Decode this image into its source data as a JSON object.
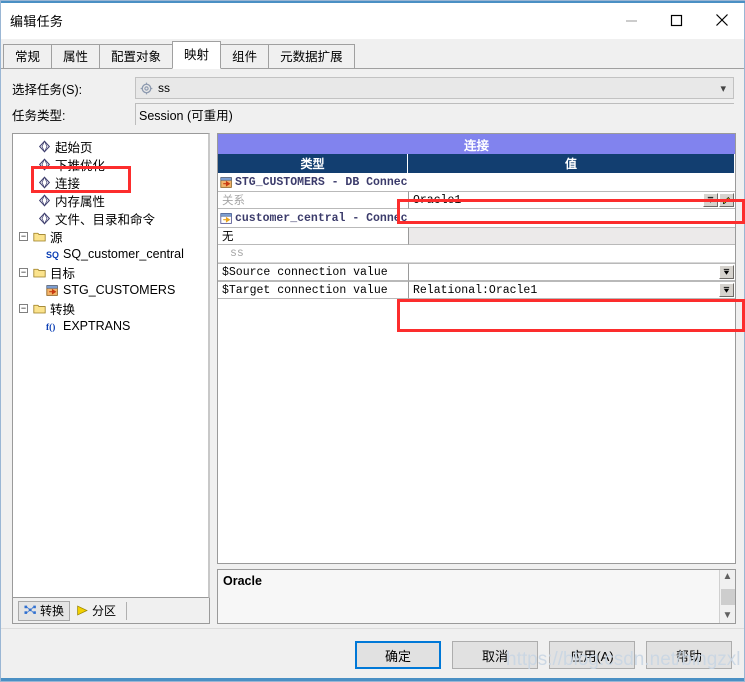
{
  "window": {
    "title": "编辑任务",
    "controls": {
      "minimize": "minimize-icon",
      "maximize": "maximize-icon",
      "close": "close-icon"
    }
  },
  "tabs": [
    {
      "label": "常规",
      "active": false
    },
    {
      "label": "属性",
      "active": false
    },
    {
      "label": "配置对象",
      "active": false
    },
    {
      "label": "映射",
      "active": true
    },
    {
      "label": "组件",
      "active": false
    },
    {
      "label": "元数据扩展",
      "active": false
    }
  ],
  "form": {
    "task_label": "选择任务(S):",
    "task_value": "ss",
    "task_icon": "gear-icon",
    "type_label": "任务类型:",
    "type_value": "Session (可重用)"
  },
  "tree": {
    "nodes": [
      {
        "label": "起始页",
        "icon": "gem-icon",
        "indent": 1,
        "expander": false
      },
      {
        "label": "下推优化",
        "icon": "gem-icon",
        "indent": 1,
        "expander": false
      },
      {
        "label": "连接",
        "icon": "gem-icon",
        "indent": 1,
        "expander": false,
        "highlight": true
      },
      {
        "label": "内存属性",
        "icon": "gem-icon",
        "indent": 1,
        "expander": false
      },
      {
        "label": "文件、目录和命令",
        "icon": "gem-icon",
        "indent": 1,
        "expander": false
      },
      {
        "label": "源",
        "icon": "folder-icon",
        "indent": 0,
        "expander": true
      },
      {
        "label": "SQ_customer_central",
        "icon": "sq-icon",
        "indent": 2,
        "expander": false
      },
      {
        "label": "目标",
        "icon": "folder-icon",
        "indent": 0,
        "expander": true
      },
      {
        "label": "STG_CUSTOMERS",
        "icon": "target-icon",
        "indent": 2,
        "expander": false
      },
      {
        "label": "转换",
        "icon": "folder-icon",
        "indent": 0,
        "expander": true
      },
      {
        "label": "EXPTRANS",
        "icon": "function-icon",
        "indent": 2,
        "expander": false
      }
    ],
    "bottom_tabs": [
      {
        "label": "转换",
        "icon": "transformations-icon",
        "selected": true
      },
      {
        "label": "分区",
        "icon": "partitions-icon",
        "selected": false
      }
    ]
  },
  "grid": {
    "title": "连接",
    "columns": [
      "类型",
      "值"
    ],
    "rows": [
      {
        "kind": "group",
        "icon": "target-icon",
        "type": "STG_CUSTOMERS - DB Connection",
        "value": ""
      },
      {
        "kind": "value",
        "icon": "",
        "type": "关系",
        "type_style": "grey",
        "value": "Oracle1",
        "dropdown": true,
        "edit": true,
        "highlight": true
      },
      {
        "kind": "group",
        "icon": "source-icon",
        "type": "customer_central - Connection",
        "value": ""
      },
      {
        "kind": "plain",
        "icon": "",
        "type": "无",
        "value": "",
        "value_grey": true
      },
      {
        "kind": "subhdr",
        "icon": "",
        "type": "ss",
        "value": ""
      },
      {
        "kind": "value",
        "icon": "",
        "type": "$Source connection value",
        "value": "",
        "dropdown": true
      },
      {
        "kind": "value",
        "icon": "",
        "type": "$Target connection value",
        "value": "Relational:Oracle1",
        "dropdown": true,
        "highlight": true
      }
    ]
  },
  "description": {
    "text": "Oracle"
  },
  "footer": {
    "buttons": [
      {
        "label": "确定",
        "default": true
      },
      {
        "label": "取消",
        "default": false
      },
      {
        "label": "应用(A)",
        "default": false
      },
      {
        "label": "帮助",
        "default": false
      }
    ]
  },
  "watermark": {
    "text": "https://blog.csdn.net/bingzxl"
  },
  "colors": {
    "title_band": "#8183ee",
    "column_header": "#123e70",
    "accent": "#4a90c4",
    "annotation": "#fc2d2d"
  }
}
